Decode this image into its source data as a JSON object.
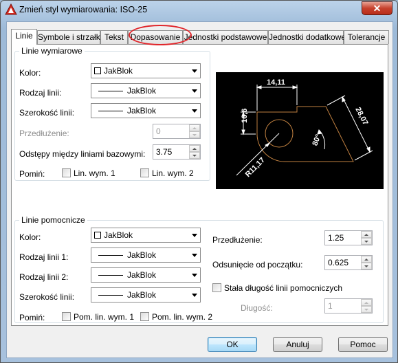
{
  "window": {
    "title": "Zmień styl wymiarowania: ISO-25",
    "close_glyph": "✕"
  },
  "tabs": [
    {
      "label": "Linie"
    },
    {
      "label": "Symbole i strzałki"
    },
    {
      "label": "Tekst"
    },
    {
      "label": "Dopasowanie"
    },
    {
      "label": "Jednostki podstawowe"
    },
    {
      "label": "Jednostki dodatkowe"
    },
    {
      "label": "Tolerancje"
    }
  ],
  "dim_lines": {
    "group_title": "Linie wymiarowe",
    "color_label": "Kolor:",
    "color_value": "JakBlok",
    "linetype_label": "Rodzaj linii:",
    "linetype_value": "JakBlok",
    "lineweight_label": "Szerokość linii:",
    "lineweight_value": "JakBlok",
    "extend_label": "Przedłużenie:",
    "extend_value": "0",
    "baseline_label": "Odstępy między liniami bazowymi:",
    "baseline_value": "3.75",
    "suppress_label": "Pomiń:",
    "suppress_1": "Lin. wym. 1",
    "suppress_2": "Lin. wym. 2"
  },
  "ext_lines": {
    "group_title": "Linie pomocnicze",
    "color_label": "Kolor:",
    "color_value": "JakBlok",
    "linetype1_label": "Rodzaj linii 1:",
    "linetype1_value": "JakBlok",
    "linetype2_label": "Rodzaj linii 2:",
    "linetype2_value": "JakBlok",
    "lineweight_label": "Szerokość linii:",
    "lineweight_value": "JakBlok",
    "suppress_label": "Pomiń:",
    "suppress_1": "Pom. lin. wym. 1",
    "suppress_2": "Pom. lin. wym. 2",
    "extend_label": "Przedłużenie:",
    "extend_value": "1.25",
    "offset_label": "Odsunięcie od początku:",
    "offset_value": "0.625",
    "fixed_label": "Stała długość linii pomocniczych",
    "length_label": "Długość:",
    "length_value": "1"
  },
  "preview": {
    "dim_top": "14,11",
    "dim_left": "16,6",
    "dim_right": "28,07",
    "dim_angle": "80°",
    "dim_radius": "R11,17"
  },
  "buttons": {
    "ok": "OK",
    "cancel": "Anuluj",
    "help": "Pomoc"
  },
  "colors": {
    "highlight": "#e0262b",
    "preview_bg": "#000000",
    "geometry": "#c08040",
    "dims": "#ffffff"
  }
}
